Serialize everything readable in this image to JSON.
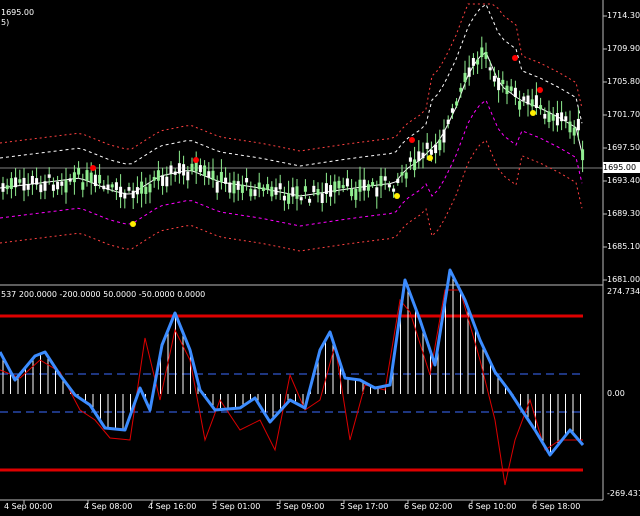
{
  "price_panel": {
    "header_line1": "1695.00",
    "header_line2": "5)",
    "y_ticks": [
      "1714.30",
      "1709.90",
      "1705.80",
      "1701.70",
      "1697.50",
      "1693.40",
      "1689.30",
      "1685.10",
      "1681.00"
    ],
    "current_price_label": "1695.00",
    "colors": {
      "bull_candle": "#90ee90",
      "bear_candle": "#ffffff",
      "grid": "#ffffff",
      "band_outer": "#ff4040",
      "band_inner": "#ffffff",
      "band_lower": "#ff00ff",
      "marker_up": "#ff0000",
      "marker_down": "#ffee00"
    }
  },
  "indicator_panel": {
    "header": "537 200.0000 -200.0000 50.0000 -50.0000 0.0000",
    "y_ticks": [
      "274.734",
      "0.00",
      "-269.431"
    ],
    "colors": {
      "main_line": "#3c8cff",
      "signal_line": "#dd0000",
      "level_line": "#dd0000",
      "dashed_level": "#3c6cff",
      "histogram": "#ffffff"
    }
  },
  "x_axis": {
    "labels": [
      "4 Sep 00:00",
      "4 Sep 08:00",
      "4 Sep 16:00",
      "5 Sep 01:00",
      "5 Sep 09:00",
      "5 Sep 17:00",
      "6 Sep 02:00",
      "6 Sep 10:00",
      "6 Sep 18:00"
    ]
  }
}
